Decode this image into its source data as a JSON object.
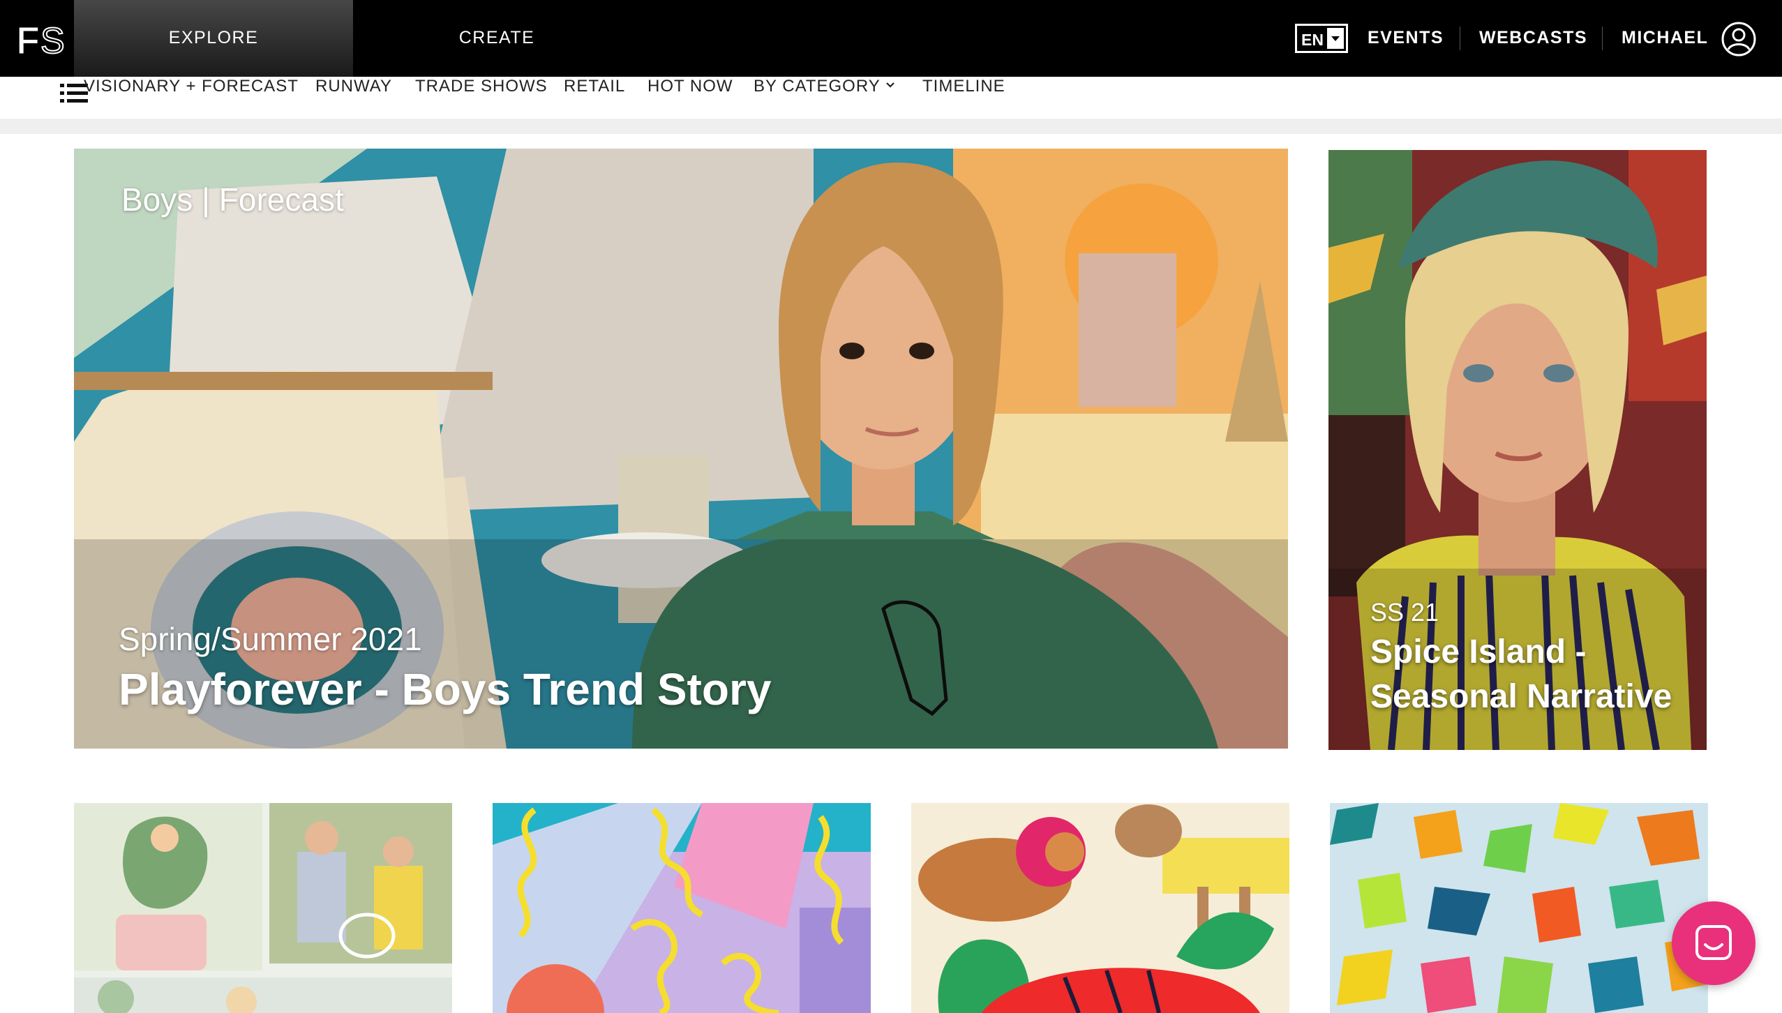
{
  "brand": {
    "logo_text": "FS"
  },
  "header": {
    "explore_label": "EXPLORE",
    "create_label": "CREATE",
    "language": "EN",
    "events_label": "EVENTS",
    "webcasts_label": "WEBCASTS",
    "user_name": "MICHAEL"
  },
  "subnav": {
    "items": [
      "VISIONARY + FORECAST",
      "RUNWAY",
      "TRADE SHOWS",
      "RETAIL",
      "HOT NOW",
      "BY CATEGORY",
      "TIMELINE"
    ]
  },
  "hero": {
    "category": "Boys | Forecast",
    "season": "Spring/Summer 2021",
    "title": "Playforever - Boys Trend Story"
  },
  "side_feature": {
    "season": "SS 21",
    "title": "Spice Island - Seasonal Narrative"
  },
  "icons": {
    "menu": "hamburger-list-icon",
    "avatar": "user-circle-icon",
    "chat": "chat-bubble-icon",
    "dropdown": "chevron-down-icon"
  },
  "colors": {
    "topbar": "#000000",
    "accent_chat": "#e8317a"
  }
}
